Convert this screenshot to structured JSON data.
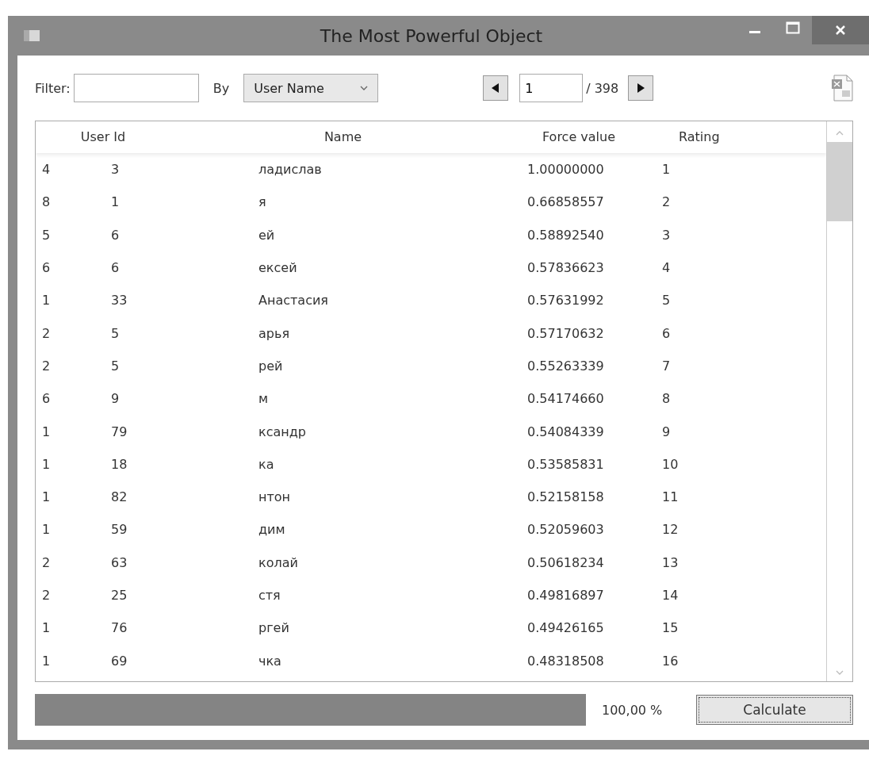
{
  "window": {
    "title": "The Most Powerful Object"
  },
  "toolbar": {
    "filter_label": "Filter:",
    "by_label": "By",
    "by_select": "User Name",
    "page_value": "1",
    "page_total": "/ 398"
  },
  "table": {
    "columns": [
      "User Id",
      "Name",
      "Force value",
      "Rating"
    ],
    "rows": [
      {
        "column_1": "4",
        "user_id": "3",
        "name": "ладислав",
        "force_value": "1.00000000",
        "rating": "1"
      },
      {
        "column_1": "8",
        "user_id": "1",
        "name": "я",
        "force_value": "0.66858557",
        "rating": "2"
      },
      {
        "column_1": "5",
        "user_id": "6",
        "name": "ей",
        "force_value": "0.58892540",
        "rating": "3"
      },
      {
        "column_1": "6",
        "user_id": "6",
        "name": "ексей",
        "force_value": "0.57836623",
        "rating": "4"
      },
      {
        "column_1": "1",
        "user_id": "33",
        "name": "Анастасия",
        "force_value": "0.57631992",
        "rating": "5"
      },
      {
        "column_1": "2",
        "user_id": "5",
        "name": "арья",
        "force_value": "0.57170632",
        "rating": "6"
      },
      {
        "column_1": "2",
        "user_id": "5",
        "name": "рей",
        "force_value": "0.55263339",
        "rating": "7"
      },
      {
        "column_1": "6",
        "user_id": "9",
        "name": "м",
        "force_value": "0.54174660",
        "rating": "8"
      },
      {
        "column_1": "1",
        "user_id": "79",
        "name": "ксандр",
        "force_value": "0.54084339",
        "rating": "9"
      },
      {
        "column_1": "1",
        "user_id": "18",
        "name": "ка",
        "force_value": "0.53585831",
        "rating": "10"
      },
      {
        "column_1": "1",
        "user_id": "82",
        "name": "нтон",
        "force_value": "0.52158158",
        "rating": "11"
      },
      {
        "column_1": "1",
        "user_id": "59",
        "name": "дим",
        "force_value": "0.52059603",
        "rating": "12"
      },
      {
        "column_1": "2",
        "user_id": "63",
        "name": "колай",
        "force_value": "0.50618234",
        "rating": "13"
      },
      {
        "column_1": "2",
        "user_id": "25",
        "name": "стя",
        "force_value": "0.49816897",
        "rating": "14"
      },
      {
        "column_1": "1",
        "user_id": "76",
        "name": "ргей",
        "force_value": "0.49426165",
        "rating": "15"
      },
      {
        "column_1": "1",
        "user_id": "69",
        "name": "чка",
        "force_value": "0.48318508",
        "rating": "16"
      }
    ]
  },
  "progress": {
    "level": 1.0,
    "reading": "100,00 %"
  },
  "calculate_button": "Calculate"
}
